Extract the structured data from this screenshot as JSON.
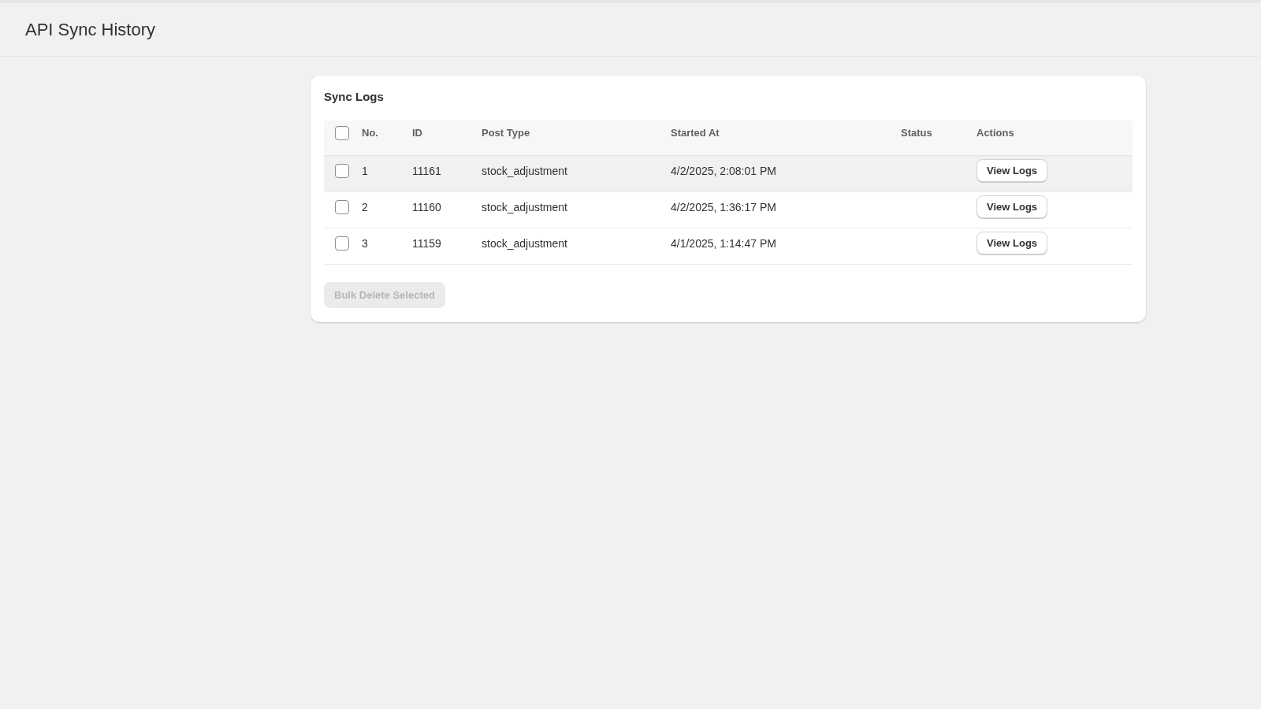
{
  "header": {
    "title": "API Sync History"
  },
  "card": {
    "title": "Sync Logs",
    "table": {
      "select_all": {
        "checked": false
      },
      "columns": [
        "No.",
        "ID",
        "Post Type",
        "Started At",
        "Status",
        "Actions"
      ],
      "rows": [
        {
          "checked": false,
          "highlighted": true,
          "no": "1",
          "id": "11161",
          "post_type": "stock_adjustment",
          "started_at": "4/2/2025, 2:08:01 PM",
          "action": "View Logs"
        },
        {
          "checked": false,
          "highlighted": false,
          "no": "2",
          "id": "11160",
          "post_type": "stock_adjustment",
          "started_at": "4/2/2025, 1:36:17 PM",
          "action": "View Logs"
        },
        {
          "checked": false,
          "highlighted": false,
          "no": "3",
          "id": "11159",
          "post_type": "stock_adjustment",
          "started_at": "4/1/2025, 1:14:47 PM",
          "action": "View Logs"
        }
      ]
    },
    "bulk_button": {
      "label": "Bulk Delete Selected",
      "disabled": true
    }
  }
}
